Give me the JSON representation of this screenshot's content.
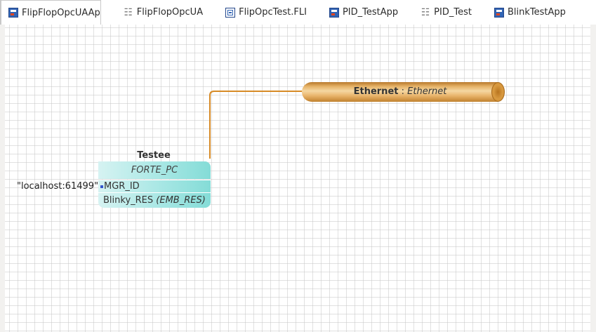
{
  "tabs": [
    {
      "label": "FlipFlopOpcUAAp",
      "icon": "system-icon",
      "active": true
    },
    {
      "label": "FlipFlopOpcUA",
      "icon": "function-block-type-icon",
      "active": false
    },
    {
      "label": "FlipOpcTest.FLI",
      "icon": "fli-file-icon",
      "active": false
    },
    {
      "label": "PID_TestApp",
      "icon": "system-icon",
      "active": false
    },
    {
      "label": "PID_Test",
      "icon": "function-block-type-icon",
      "active": false
    },
    {
      "label": "BlinkTestApp",
      "icon": "system-icon",
      "active": false
    }
  ],
  "segment": {
    "name": "Ethernet",
    "separator": ":",
    "type": "Ethernet",
    "color": "#e6b368"
  },
  "device": {
    "name": "Testee",
    "type": "FORTE_PC",
    "parameter": {
      "name": "MGR_ID",
      "value": "\"localhost:61499\""
    },
    "resource": {
      "name": "Blinky_RES",
      "type": "(EMB_RES)"
    },
    "color": "#a4e6e3"
  },
  "connection": {
    "color": "#d78a25"
  }
}
